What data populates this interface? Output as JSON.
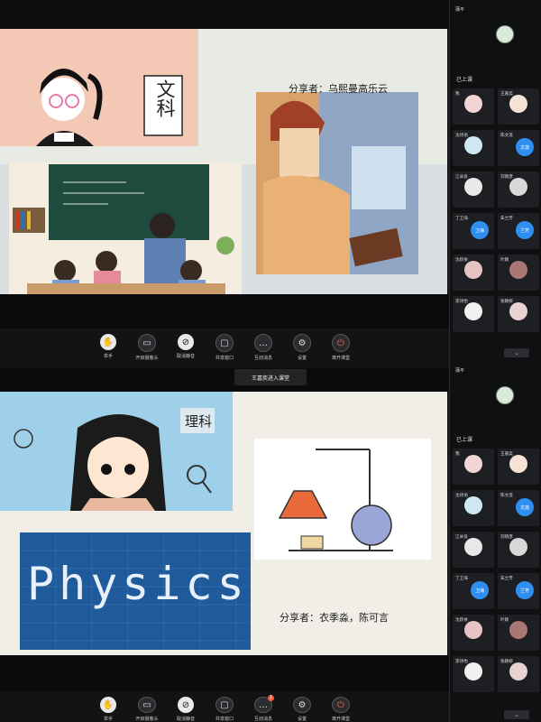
{
  "top_slide": {
    "category": "文科",
    "sharer": "分享者：乌熙曼高乐云"
  },
  "bottom_slide": {
    "category": "理科",
    "sharer": "分享者：衣季淼，陈可言",
    "physics_word": "Physics"
  },
  "toolbar": {
    "items": [
      {
        "label": "举手",
        "icon": "hand-icon"
      },
      {
        "label": "开启摄像头",
        "icon": "camera-off-icon"
      },
      {
        "label": "取消静音",
        "icon": "mic-off-icon"
      },
      {
        "label": "共享窗口",
        "icon": "screen-share-icon"
      },
      {
        "label": "互动消息",
        "icon": "chat-icon"
      },
      {
        "label": "设置",
        "icon": "gear-icon"
      },
      {
        "label": "离开课堂",
        "icon": "power-icon"
      }
    ],
    "message_badge": "1"
  },
  "notice": "王嘉奕进入课堂",
  "sidebar": {
    "host_label": "蒲平",
    "section_title": "已上课",
    "participants": [
      {
        "name": "我",
        "badge": "",
        "color": "#f2d4d4"
      },
      {
        "name": "王嘉奕",
        "badge": "",
        "color": "#f6e2d6"
      },
      {
        "name": "沈诗语",
        "badge": "",
        "color": "#cfe6f3"
      },
      {
        "name": "陈文莲",
        "badge": "文莲",
        "color": ""
      },
      {
        "name": "江卓良",
        "badge": "",
        "color": "#e8e8e8"
      },
      {
        "name": "刘晓彦",
        "badge": "",
        "color": "#d8d8d8"
      },
      {
        "name": "丁卫海",
        "badge": "卫海",
        "color": ""
      },
      {
        "name": "朱兰芳",
        "badge": "兰芳",
        "color": ""
      },
      {
        "name": "沈跃依",
        "badge": "",
        "color": "#e7c4c4"
      },
      {
        "name": "叶颖",
        "badge": "",
        "color": "#a77"
      },
      {
        "name": "李诗怡",
        "badge": "",
        "color": "#f0f0f0"
      },
      {
        "name": "张颖妍",
        "badge": "",
        "color": "#e9d2d2"
      }
    ],
    "collapse_icon": "chevron-down-icon"
  },
  "colors": {
    "accent_blue": "#2e8ff0",
    "leave_red": "#ff5b4a"
  }
}
